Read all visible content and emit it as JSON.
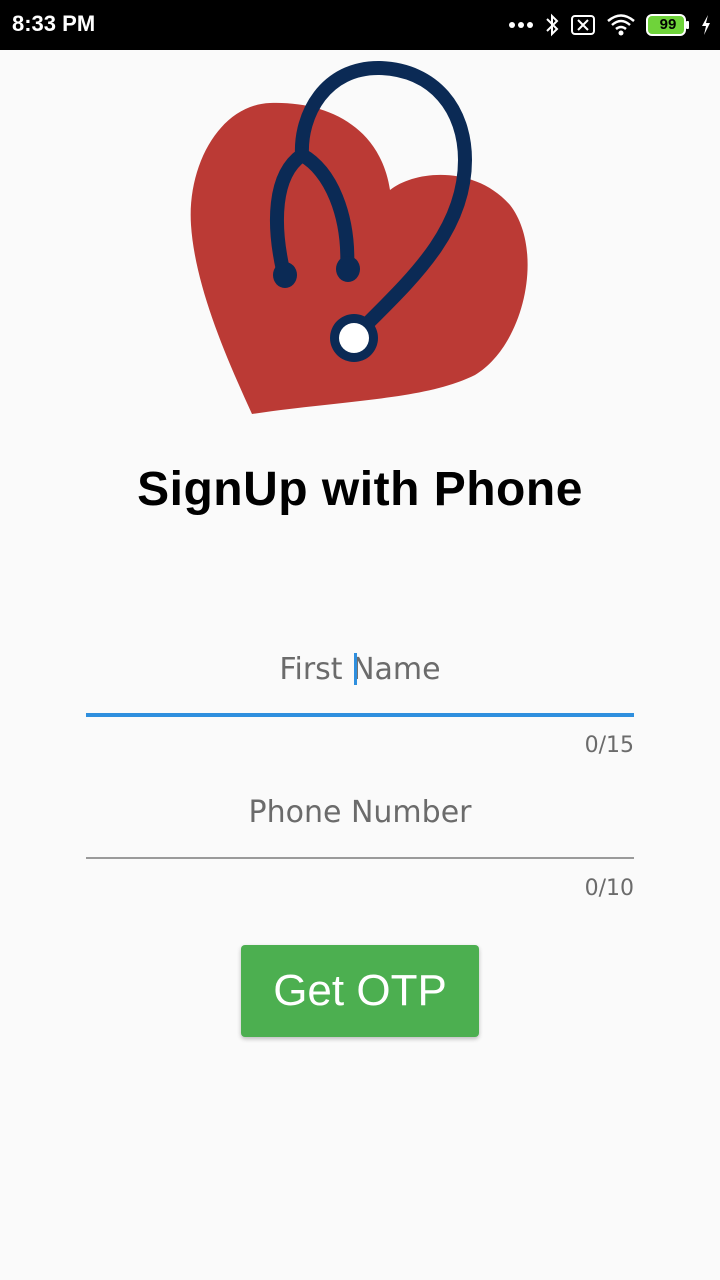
{
  "status_bar": {
    "time": "8:33 PM",
    "battery_level": "99",
    "icons": [
      "more-dots-icon",
      "bluetooth-icon",
      "sim-blocked-icon",
      "wifi-icon",
      "battery-icon",
      "charging-bolt-icon"
    ]
  },
  "logo": {
    "icon": "heart-stethoscope-logo-icon",
    "heart_color": "#bb3a35",
    "stethoscope_color": "#0b2a55"
  },
  "page": {
    "title": "SignUp with Phone"
  },
  "form": {
    "first_name": {
      "placeholder": "First Name",
      "value": "",
      "counter": "0/15"
    },
    "phone": {
      "placeholder": "Phone Number",
      "value": "",
      "counter": "0/10"
    },
    "submit_label": "Get OTP"
  },
  "colors": {
    "accent": "#2f8fde",
    "button": "#4caf50",
    "background": "#fafafa"
  }
}
